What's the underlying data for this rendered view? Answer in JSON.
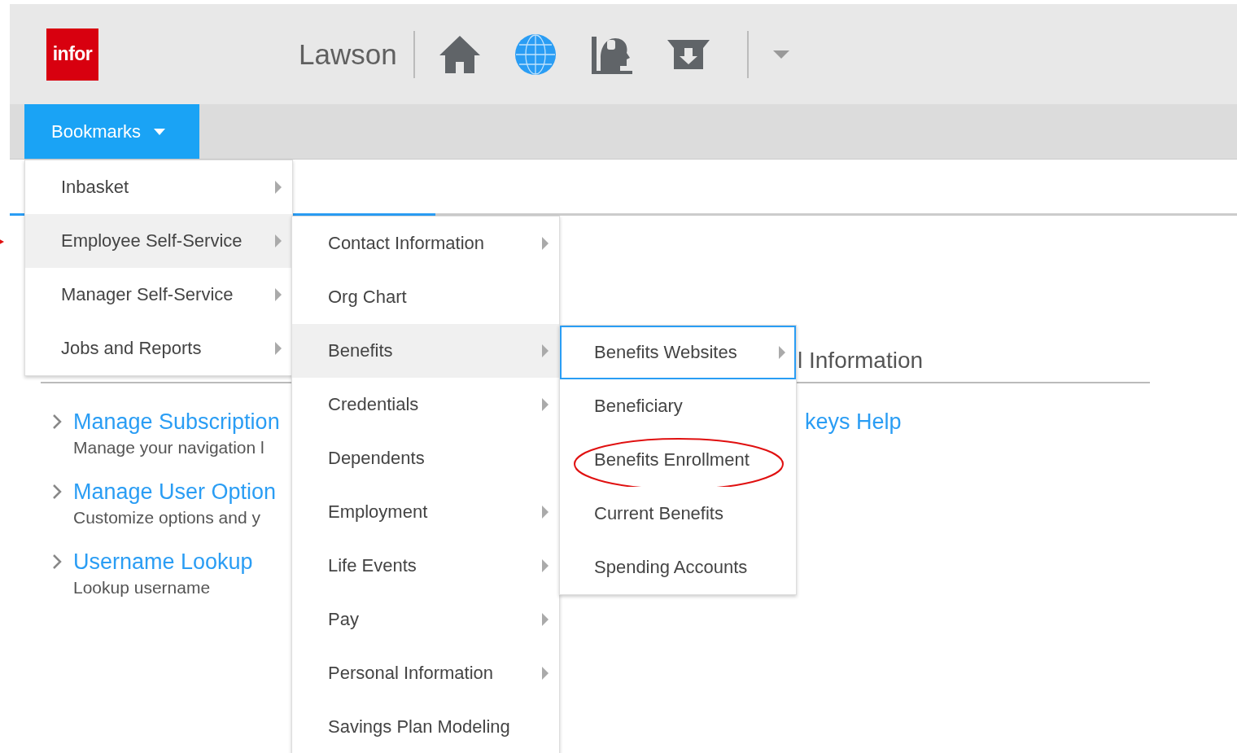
{
  "header": {
    "logo": "infor",
    "app_title": "Lawson",
    "bookmarks_button": "Bookmarks"
  },
  "page": {
    "section_heading": "l Information",
    "links": [
      {
        "title": "Manage Subscription",
        "description": "Manage your navigation l"
      },
      {
        "title": "Manage User Option",
        "description": "Customize options and y"
      },
      {
        "title": "Username Lookup",
        "description": "Lookup username"
      }
    ],
    "side_link": "keys Help"
  },
  "bookmarks_menu": [
    {
      "label": "Inbasket",
      "has_submenu": true,
      "selected": false,
      "pointed": false
    },
    {
      "label": "Employee Self-Service",
      "has_submenu": true,
      "selected": true,
      "pointed": true
    },
    {
      "label": "Manager Self-Service",
      "has_submenu": true,
      "selected": false,
      "pointed": false
    },
    {
      "label": "Jobs and Reports",
      "has_submenu": true,
      "selected": false,
      "pointed": false
    }
  ],
  "employee_menu": [
    {
      "label": "Contact Information",
      "has_submenu": true,
      "selected": false
    },
    {
      "label": "Org Chart",
      "has_submenu": false,
      "selected": false
    },
    {
      "label": "Benefits",
      "has_submenu": true,
      "selected": true
    },
    {
      "label": "Credentials",
      "has_submenu": true,
      "selected": false
    },
    {
      "label": "Dependents",
      "has_submenu": false,
      "selected": false
    },
    {
      "label": "Employment",
      "has_submenu": true,
      "selected": false
    },
    {
      "label": "Life Events",
      "has_submenu": true,
      "selected": false
    },
    {
      "label": "Pay",
      "has_submenu": true,
      "selected": false
    },
    {
      "label": "Personal Information",
      "has_submenu": true,
      "selected": false
    },
    {
      "label": "Savings Plan Modeling",
      "has_submenu": false,
      "selected": false
    }
  ],
  "benefits_menu": [
    {
      "label": "Benefits Websites",
      "has_submenu": true,
      "selected": true,
      "circled": false
    },
    {
      "label": "Beneficiary",
      "has_submenu": false,
      "selected": false,
      "circled": false
    },
    {
      "label": "Benefits Enrollment",
      "has_submenu": false,
      "selected": false,
      "circled": true
    },
    {
      "label": "Current Benefits",
      "has_submenu": false,
      "selected": false,
      "circled": false
    },
    {
      "label": "Spending Accounts",
      "has_submenu": false,
      "selected": false,
      "circled": false
    }
  ]
}
